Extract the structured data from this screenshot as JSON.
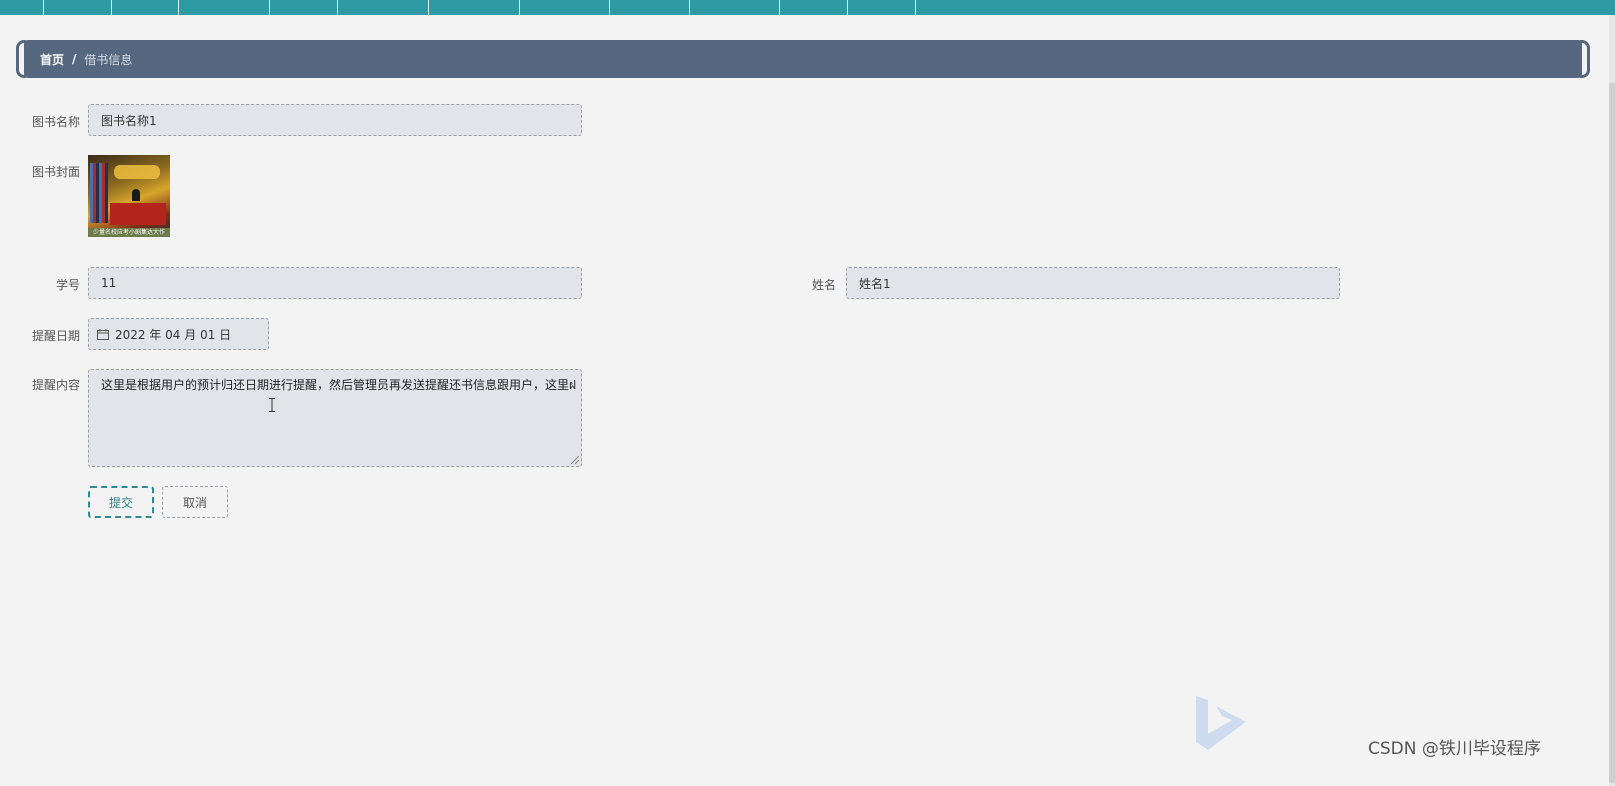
{
  "breadcrumb": {
    "home": "首页",
    "separator": "/",
    "current": "借书信息"
  },
  "form": {
    "book_name": {
      "label": "图书名称",
      "value": "图书名称1"
    },
    "book_cover": {
      "label": "图书封面",
      "cover_strip_text": "少量名校应考小剧集达大作"
    },
    "student_id": {
      "label": "学号",
      "value": "11"
    },
    "student_name": {
      "label": "姓名",
      "value": "姓名1"
    },
    "remind_date": {
      "label": "提醒日期",
      "value": "2022 年 04 月 01 日",
      "icon": "calendar-icon"
    },
    "remind_content": {
      "label": "提醒内容",
      "value": "这里是根据用户的预计归还日期进行提醒，然后管理员再发送提醒还书信息跟用户，这里ฝ"
    }
  },
  "buttons": {
    "submit": "提交",
    "cancel": "取消"
  },
  "watermark": "CSDN @铁川毕设程序",
  "colors": {
    "topnav": "#2e9aa3",
    "breadcrumb_bg": "#56687f",
    "submit_accent": "#2e8a92"
  }
}
